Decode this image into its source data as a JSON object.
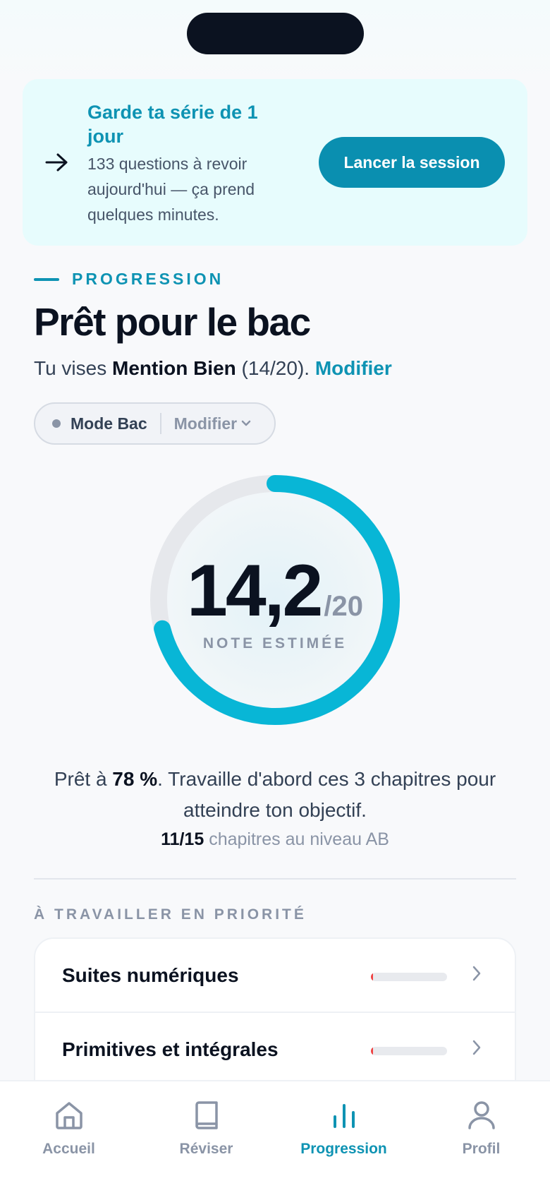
{
  "streak": {
    "title": "Garde ta série de 1 jour",
    "text": "133 questions à revoir aujourd'hui — ça prend quelques minutes.",
    "button": "Lancer la session"
  },
  "progress": {
    "eyebrow": "PROGRESSION",
    "title": "Prêt pour le bac",
    "goal_prefix": "Tu vises",
    "goal_target": "Mention Bien",
    "goal_score": "(14/20).",
    "goal_edit": "Modifier",
    "mode_label": "Mode Bac",
    "mode_edit": "Modifier"
  },
  "gauge": {
    "score": "14,2",
    "max": "/20",
    "label": "NOTE ESTIMÉE",
    "fraction": 0.71,
    "color": "#08b6d6"
  },
  "readiness": {
    "prefix": "Prêt à",
    "percent": "78 %",
    "suffix": ". Travaille d'abord ces 3 chapitres pour atteindre ton objectif.",
    "chapters_count": "11/15",
    "chapters_text": "chapitres au niveau AB"
  },
  "priority": {
    "title": "À TRAVAILLER EN PRIORITÉ",
    "items": [
      {
        "name": "Suites numériques",
        "level": 0.03
      },
      {
        "name": "Primitives et intégrales",
        "level": 0.03
      }
    ]
  },
  "nav": {
    "items": [
      {
        "label": "Accueil",
        "icon": "home-icon"
      },
      {
        "label": "Réviser",
        "icon": "book-icon"
      },
      {
        "label": "Progression",
        "icon": "chart-icon"
      },
      {
        "label": "Profil",
        "icon": "user-icon"
      }
    ],
    "active": "Progression"
  }
}
